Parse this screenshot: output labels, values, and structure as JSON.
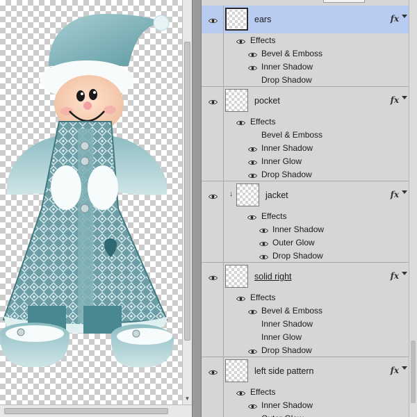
{
  "layers": [
    {
      "name": "ears",
      "selected": true,
      "clipped": false,
      "effects_label": "Effects",
      "effects": [
        {
          "label": "Bevel & Emboss",
          "visible": true
        },
        {
          "label": "Inner Shadow",
          "visible": true
        },
        {
          "label": "Drop Shadow",
          "visible": false
        }
      ]
    },
    {
      "name": "pocket",
      "selected": false,
      "clipped": false,
      "effects_label": "Effects",
      "effects": [
        {
          "label": "Bevel & Emboss",
          "visible": false
        },
        {
          "label": "Inner Shadow",
          "visible": true
        },
        {
          "label": "Inner Glow",
          "visible": true
        },
        {
          "label": "Drop Shadow",
          "visible": true
        }
      ]
    },
    {
      "name": "jacket",
      "selected": false,
      "clipped": true,
      "effects_label": "Effects",
      "effects": [
        {
          "label": "Inner Shadow",
          "visible": true
        },
        {
          "label": "Outer Glow",
          "visible": true
        },
        {
          "label": "Drop Shadow",
          "visible": true
        }
      ]
    },
    {
      "name": "solid right",
      "selected": false,
      "clipped": false,
      "underlined": true,
      "effects_label": "Effects",
      "effects": [
        {
          "label": "Bevel & Emboss",
          "visible": true
        },
        {
          "label": "Inner Shadow",
          "visible": false
        },
        {
          "label": "Inner Glow",
          "visible": false
        },
        {
          "label": "Drop Shadow",
          "visible": true
        }
      ]
    },
    {
      "name": "left side pattern",
      "selected": false,
      "clipped": false,
      "effects_label": "Effects",
      "effects": [
        {
          "label": "Inner Shadow",
          "visible": true
        },
        {
          "label": "Outer Glow",
          "visible": true
        }
      ]
    }
  ],
  "icons": {
    "visibility": "eye-icon",
    "layer_style": "fx-icon",
    "clipping": "clipping-arrow-icon"
  },
  "fx_symbol": "fx",
  "colors": {
    "selected_row": "#b8ccf2",
    "panel_bg": "#d6d6d6",
    "elf_teal": "#5f9aa2"
  }
}
